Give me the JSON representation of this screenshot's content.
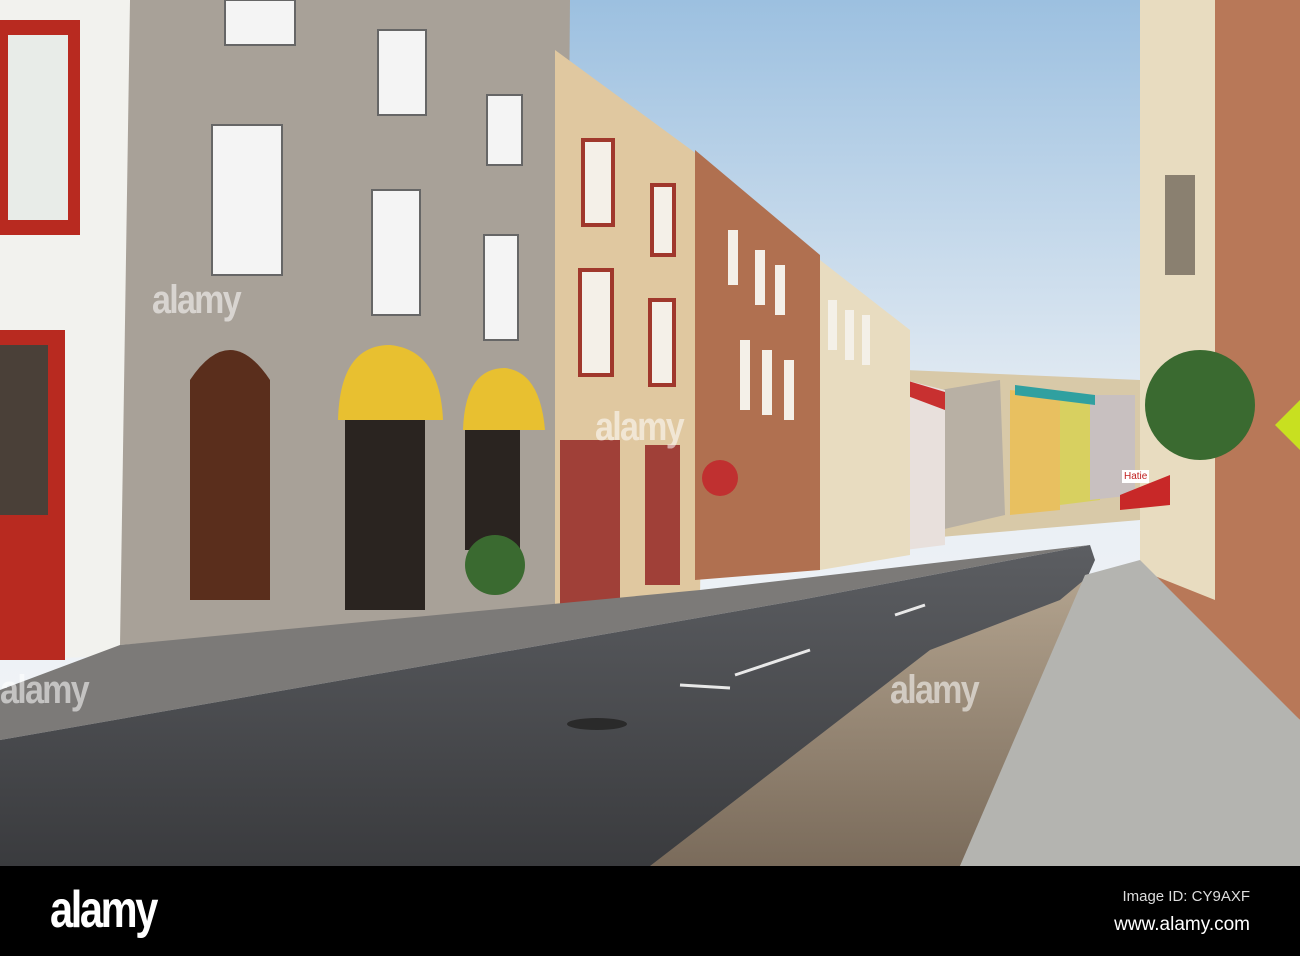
{
  "watermark": {
    "text": "alamy"
  },
  "footer": {
    "logo": "alamy",
    "image_id": "Image ID: CY9AXF",
    "site": "www.alamy.com"
  },
  "signs": {
    "shop_sign": "Hatie"
  }
}
